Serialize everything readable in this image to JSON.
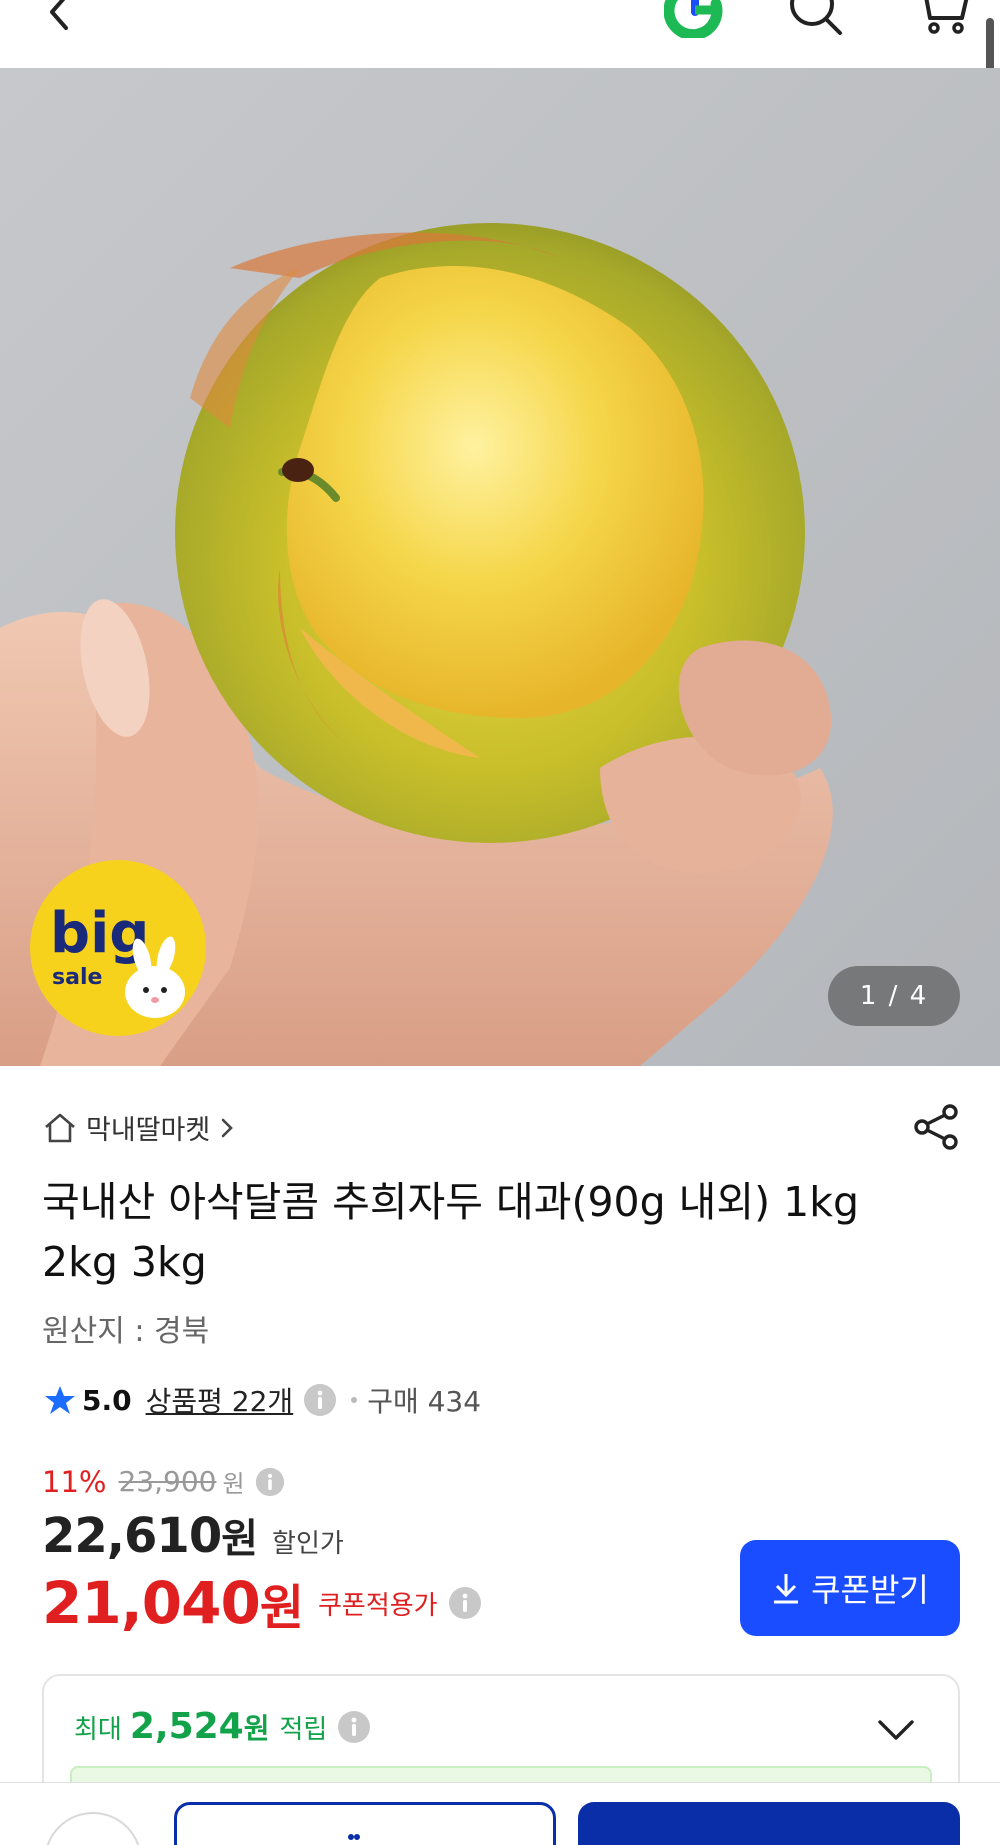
{
  "header": {
    "back_icon": "chevron-left-icon",
    "logo_icon": "g-logo-icon",
    "search_icon": "search-icon",
    "cart_icon": "cart-icon"
  },
  "gallery": {
    "counter": "1 / 4",
    "badge_big": "big",
    "badge_sale": "sale"
  },
  "store": {
    "name": "막내딸마켓"
  },
  "product": {
    "title": "국내산 아삭달콤 추희자두 대과(90g 내외) 1kg 2kg 3kg",
    "origin": "원산지 : 경북"
  },
  "rating": {
    "score": "5.0",
    "reviews": "상품평 22개",
    "sold": "구매 434"
  },
  "price": {
    "discount_pct": "11%",
    "original": "23,900",
    "original_unit": "원",
    "sale_amount": "22,610",
    "sale_unit": "원",
    "sale_label": "할인가",
    "coupon_amount": "21,040",
    "coupon_unit": "원",
    "coupon_label": "쿠폰적용가",
    "coupon_button": "쿠폰받기"
  },
  "points": {
    "prefix": "최대",
    "amount": "2,524",
    "unit": "원",
    "suffix": "적립"
  },
  "colors": {
    "accent_blue": "#1a4dff",
    "dark_blue": "#0a2ea8",
    "price_red": "#e02020",
    "points_green": "#12a34a"
  }
}
